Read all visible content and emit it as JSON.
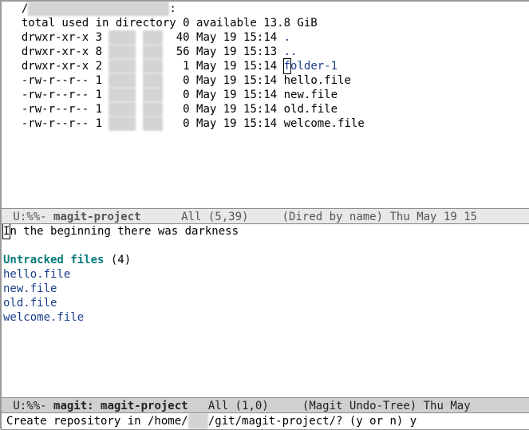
{
  "dired": {
    "header_prefix": "  /",
    "header_blur": "████/███/████████████",
    "header_suffix": ":",
    "total_line": "  total used in directory 0 available 13.8 GiB",
    "rows": [
      {
        "perms": "drwxr-xr-x",
        "links": "3",
        "user_blur": "████",
        "group_blur": "███",
        "size": "40",
        "date": "May 19 15:14",
        "name": ".",
        "is_link": true,
        "highlight": false
      },
      {
        "perms": "drwxr-xr-x",
        "links": "8",
        "user_blur": "████",
        "group_blur": "███",
        "size": "56",
        "date": "May 19 15:13",
        "name": "..",
        "is_link": true,
        "highlight": false
      },
      {
        "perms": "drwxr-xr-x",
        "links": "2",
        "user_blur": "████",
        "group_blur": "███",
        "size": "1",
        "date": "May 19 15:14",
        "name": "folder-1",
        "is_link": true,
        "highlight": true
      },
      {
        "perms": "-rw-r--r--",
        "links": "1",
        "user_blur": "████",
        "group_blur": "███",
        "size": "0",
        "date": "May 19 15:14",
        "name": "hello.file",
        "is_link": false,
        "highlight": false
      },
      {
        "perms": "-rw-r--r--",
        "links": "1",
        "user_blur": "████",
        "group_blur": "███",
        "size": "0",
        "date": "May 19 15:14",
        "name": "new.file",
        "is_link": false,
        "highlight": false
      },
      {
        "perms": "-rw-r--r--",
        "links": "1",
        "user_blur": "████",
        "group_blur": "███",
        "size": "0",
        "date": "May 19 15:14",
        "name": "old.file",
        "is_link": false,
        "highlight": false
      },
      {
        "perms": "-rw-r--r--",
        "links": "1",
        "user_blur": "████",
        "group_blur": "███",
        "size": "0",
        "date": "May 19 15:14",
        "name": "welcome.file",
        "is_link": false,
        "highlight": false
      }
    ]
  },
  "modeline_top": {
    "left": " U:%%- ",
    "buffer": "magit-project",
    "pos": "      All (5,39)     ",
    "mode": "(Dired by name)",
    "date": " Thu May 19 15"
  },
  "magit": {
    "head_first": "I",
    "head_rest": "n the beginning there was darkness",
    "untracked_label": "Untracked files",
    "untracked_count": " (4)",
    "files": [
      "hello.file",
      "new.file",
      "old.file",
      "welcome.file"
    ]
  },
  "modeline_bottom": {
    "left": " U:%%- ",
    "buffer": "magit: magit-project",
    "pos": "   All (1,0)     ",
    "mode": "(Magit Undo-Tree)",
    "date": " Thu May "
  },
  "minibuffer": {
    "prompt_prefix": "Create repository in /home/",
    "prompt_blur": "███",
    "prompt_suffix": "/git/magit-project/? (y or n) ",
    "answer": "y"
  }
}
